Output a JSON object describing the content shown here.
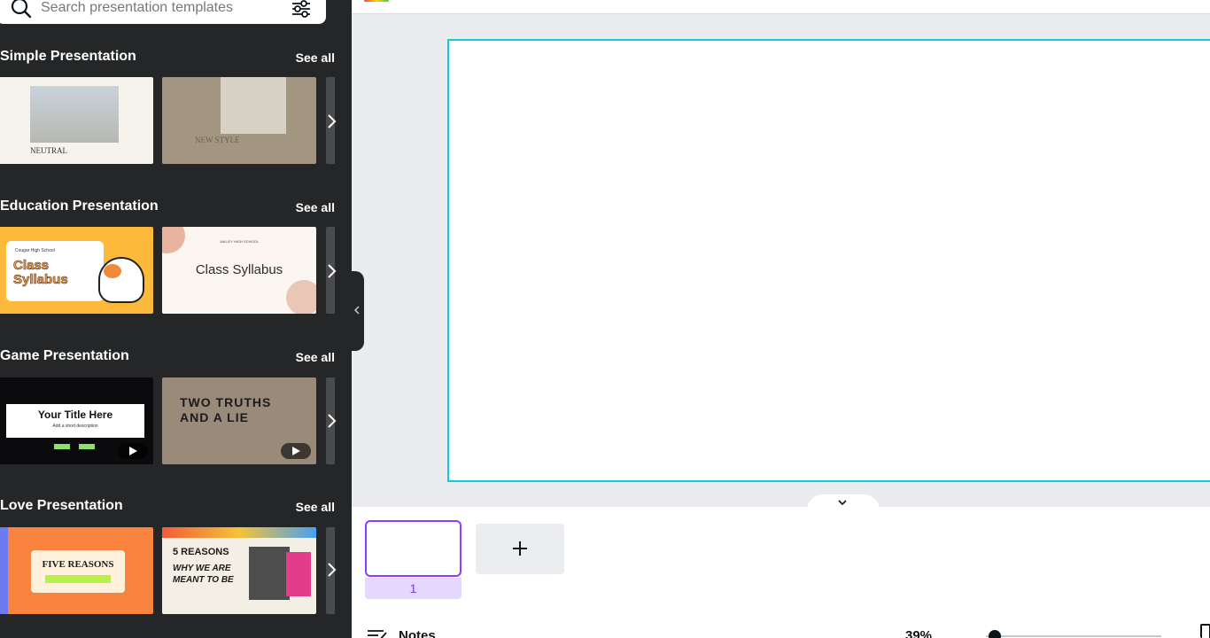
{
  "search": {
    "placeholder": "Search presentation templates"
  },
  "sections": [
    {
      "title": "Simple Presentation",
      "see_all": "See all",
      "thumbs": [
        {
          "caption": "NEUTRAL"
        },
        {
          "caption": "NEW STYLE"
        }
      ]
    },
    {
      "title": "Education Presentation",
      "see_all": "See all",
      "thumbs": [
        {
          "caption": "Class Syllabus",
          "sub": "Cougar High School"
        },
        {
          "caption": "Class Syllabus",
          "sub": "VALLEY HIGH SCHOOL"
        }
      ]
    },
    {
      "title": "Game Presentation",
      "see_all": "See all",
      "thumbs": [
        {
          "caption": "Your Title Here",
          "sub": "Add a short description"
        },
        {
          "caption": "TWO TRUTHS AND A LIE"
        }
      ]
    },
    {
      "title": "Love Presentation",
      "see_all": "See all",
      "thumbs": [
        {
          "caption": "FIVE REASONS"
        },
        {
          "caption": "WHY WE ARE MEANT TO BE",
          "sub": "5 REASONS"
        }
      ]
    }
  ],
  "pages": {
    "current": "1",
    "notes_label": "Notes",
    "zoom": "39%"
  },
  "icons": {
    "search": "search-icon",
    "filter": "filter-icon",
    "next": "chevron-right-icon",
    "collapse": "chevron-left-icon",
    "toggle": "chevron-down-icon",
    "add": "plus-icon",
    "notes": "notes-icon"
  },
  "colors": {
    "accent": "#8b3dff",
    "canvas_border": "#13c8d8",
    "panel": "#252627"
  }
}
